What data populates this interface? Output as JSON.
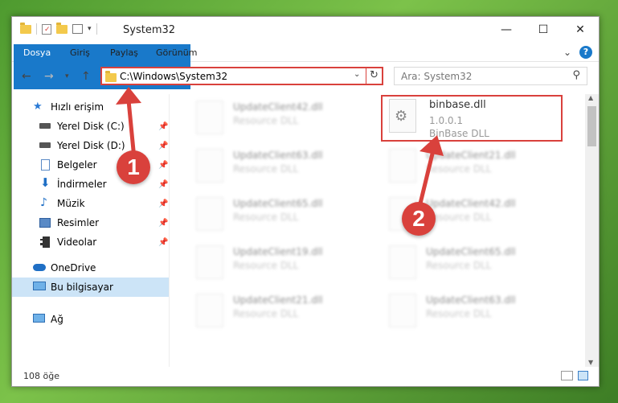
{
  "window": {
    "title": "System32",
    "minimize": "—",
    "maximize": "☐",
    "close": "✕"
  },
  "ribbon": {
    "tabs": [
      "Dosya",
      "Giriş",
      "Paylaş",
      "Görünüm"
    ],
    "expand": "⌄",
    "help": "?"
  },
  "address": {
    "path": "C:\\Windows\\System32",
    "search_placeholder": "Ara: System32"
  },
  "nav": {
    "quick_access": "Hızlı erişim",
    "items": [
      {
        "label": "Yerel Disk (C:)",
        "icon": "drive-icon"
      },
      {
        "label": "Yerel Disk (D:)",
        "icon": "drive-icon"
      },
      {
        "label": "Belgeler",
        "icon": "document-icon"
      },
      {
        "label": "İndirmeler",
        "icon": "download-icon"
      },
      {
        "label": "Müzik",
        "icon": "music-icon"
      },
      {
        "label": "Resimler",
        "icon": "pictures-icon"
      },
      {
        "label": "Videolar",
        "icon": "video-icon"
      }
    ],
    "onedrive": "OneDrive",
    "this_pc": "Bu bilgisayar",
    "network": "Ağ"
  },
  "files": {
    "left": [
      {
        "name": "UpdateClient42.dll",
        "type": "Resource DLL"
      },
      {
        "name": "UpdateClient63.dll",
        "type": "Resource DLL"
      },
      {
        "name": "UpdateClient65.dll",
        "type": "Resource DLL"
      },
      {
        "name": "UpdateClient19.dll",
        "type": "Resource DLL"
      },
      {
        "name": "UpdateClient21.dll",
        "type": "Resource DLL"
      }
    ],
    "right": [
      {
        "name": "binbase.dll",
        "version": "1.0.0.1",
        "type": "BinBase DLL"
      },
      {
        "name": "UpdateClient21.dll",
        "type": "Resource DLL"
      },
      {
        "name": "UpdateClient42.dll",
        "type": "Resource DLL"
      },
      {
        "name": "UpdateClient65.dll",
        "type": "Resource DLL"
      },
      {
        "name": "UpdateClient63.dll",
        "type": "Resource DLL"
      }
    ]
  },
  "status": {
    "count": "108 öğe"
  },
  "markers": [
    "1",
    "2"
  ],
  "colors": {
    "accent": "#1979ca",
    "highlight": "#d9413c",
    "selected": "#cce4f7"
  }
}
